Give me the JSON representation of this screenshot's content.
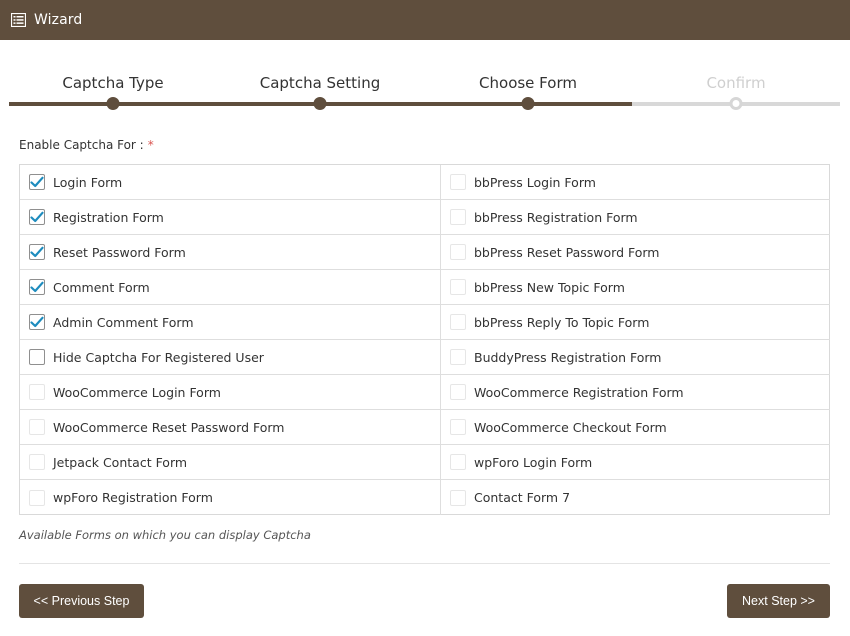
{
  "header": {
    "title": "Wizard",
    "icon": "list-icon"
  },
  "steps": [
    {
      "label": "Captcha Type",
      "state": "done"
    },
    {
      "label": "Captcha Setting",
      "state": "done"
    },
    {
      "label": "Choose Form",
      "state": "active"
    },
    {
      "label": "Confirm",
      "state": "inactive"
    }
  ],
  "form": {
    "label": "Enable Captcha For :",
    "required_mark": "*",
    "left": [
      {
        "label": "Login Form",
        "checked": true
      },
      {
        "label": "Registration Form",
        "checked": true
      },
      {
        "label": "Reset Password Form",
        "checked": true
      },
      {
        "label": "Comment Form",
        "checked": true
      },
      {
        "label": "Admin Comment Form",
        "checked": true
      },
      {
        "label": "Hide Captcha For Registered User",
        "checked": false
      },
      {
        "label": "WooCommerce Login Form",
        "checked": false
      },
      {
        "label": "WooCommerce Reset Password Form",
        "checked": false
      },
      {
        "label": "Jetpack Contact Form",
        "checked": false
      },
      {
        "label": "wpForo Registration Form",
        "checked": false
      }
    ],
    "right": [
      {
        "label": "bbPress Login Form",
        "checked": false
      },
      {
        "label": "bbPress Registration Form",
        "checked": false
      },
      {
        "label": "bbPress Reset Password Form",
        "checked": false
      },
      {
        "label": "bbPress New Topic Form",
        "checked": false
      },
      {
        "label": "bbPress Reply To Topic Form",
        "checked": false
      },
      {
        "label": "BuddyPress Registration Form",
        "checked": false
      },
      {
        "label": "WooCommerce Registration Form",
        "checked": false
      },
      {
        "label": "WooCommerce Checkout Form",
        "checked": false
      },
      {
        "label": "wpForo Login Form",
        "checked": false
      },
      {
        "label": "Contact Form 7",
        "checked": false
      }
    ],
    "note": "Available Forms on which you can display Captcha"
  },
  "buttons": {
    "prev_label": "<< Previous Step",
    "next_label": "Next Step >>"
  },
  "colors": {
    "brand": "#5f4e3d",
    "check": "#1e8cbe",
    "inactive": "#d8d8d8"
  }
}
